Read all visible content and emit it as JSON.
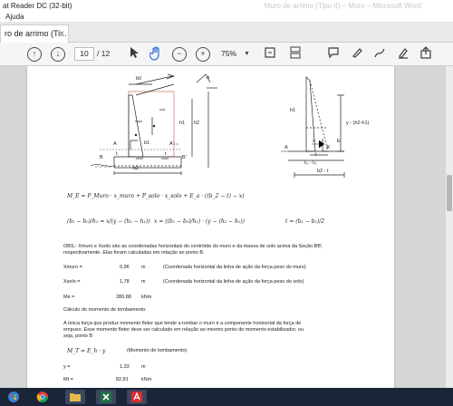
{
  "window": {
    "title": "at Reader DC (32-bit)",
    "faint_title": "Muro de arrimo (Tipo II) – Muro – Microsoft Word"
  },
  "menu": {
    "help": "Ajuda"
  },
  "tab": {
    "label": "ro de arrimo (Ti...",
    "close": "×"
  },
  "toolbar": {
    "page_current": "10",
    "page_total": "/ 12",
    "zoom": "75%"
  },
  "figure": {
    "left": {
      "b0": "b0",
      "alpha": "α",
      "h1": "h1",
      "h2": "h2",
      "solo": "solo",
      "muro": "muro",
      "b1": "b1",
      "A": "A",
      "A_prime": "A'",
      "B": "B",
      "B_prime": "B'",
      "t1": "t",
      "t2": "t",
      "b2": "b2",
      "angle": "α"
    },
    "right": {
      "h1": "h1",
      "y_label": "y - (h2-h1)",
      "A": "A",
      "Ap": "A'",
      "x": "x",
      "t": "t",
      "E": "E",
      "b_expr": "b₁ − b₀",
      "b2t": "b2 - t"
    }
  },
  "doc": {
    "eq1": "M_E = P_Muro · x_muro + P_solo · x_solo + E_a · ((b_2 − t) − x)",
    "eq2_lhs": "(b₁ − b₀)/h₁ = x/(y − (h₂ − h₁))",
    "eq2_mid": "x = ((b₁ − b₀)/h₁) · (y − (h₂ − h₁))",
    "eq2_rhs": "t = (b₁ − b₁)/2",
    "obs_line1": "OBS.: Xmuro e Xsolo são as coordenadas horizontais do centróide do muro e da massa de solo acima da Seção BB',",
    "obs_line2": "respectivamente. Elas foram calculadas em relação ao ponto B.",
    "rows": [
      {
        "label": "Xmuro =",
        "value": "0,96",
        "unit": "m",
        "note": "(Coordenada horizontal da linha de ação da força peso do muro)"
      },
      {
        "label": "Xsolo =",
        "value": "1,78",
        "unit": "m",
        "note": "(Coordenada horizontal da linha de ação da força peso do solo)"
      },
      {
        "label": "Me =",
        "value": "280,88",
        "unit": "kNm",
        "note": ""
      }
    ],
    "section_title": "Cálculo do momento de tombamento:",
    "para1": "A única força que produz momento fletor que tende a tombar o muro é a componente horizontal da força de",
    "para2": "empuxo. Esse momento fletor deve ser calculado em relação ao mesmo ponto do momento estabilizador, ou",
    "para3": "seja, ponto B",
    "mt_eq": "M_T = E_h · y",
    "mt_note": "(Momento de tombamento)",
    "rows2": [
      {
        "label": "y =",
        "value": "1,33",
        "unit": "m"
      },
      {
        "label": "Mt =",
        "value": "82,81",
        "unit": "kNm"
      }
    ]
  }
}
